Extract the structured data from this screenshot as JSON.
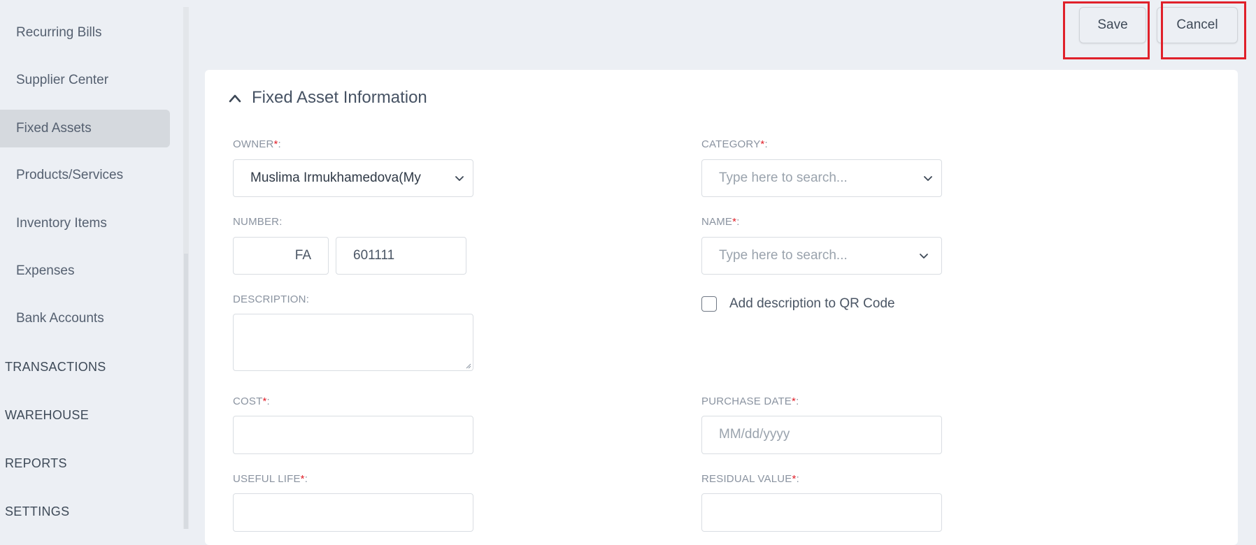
{
  "sidebar": {
    "items": [
      {
        "label": "Recurring Bills"
      },
      {
        "label": "Supplier Center"
      },
      {
        "label": "Fixed Assets",
        "active": true
      },
      {
        "label": "Products/Services"
      },
      {
        "label": "Inventory Items"
      },
      {
        "label": "Expenses"
      },
      {
        "label": "Bank Accounts"
      }
    ],
    "sections": [
      "TRANSACTIONS",
      "WAREHOUSE",
      "REPORTS",
      "SETTINGS"
    ]
  },
  "toolbar": {
    "save_label": "Save",
    "cancel_label": "Cancel",
    "highlight_color": "#e0202a"
  },
  "form": {
    "section_title": "Fixed Asset Information",
    "owner": {
      "label": "OWNER",
      "value": "Muslima Irmukhamedova(My"
    },
    "category": {
      "label": "CATEGORY",
      "placeholder": "Type here to search..."
    },
    "number": {
      "label": "NUMBER:",
      "prefix": "FA",
      "value": "601111"
    },
    "name": {
      "label": "NAME",
      "placeholder": "Type here to search..."
    },
    "description": {
      "label": "DESCRIPTION:"
    },
    "qr_checkbox_label": "Add description to QR Code",
    "cost": {
      "label": "COST"
    },
    "purchase_date": {
      "label": "PURCHASE DATE",
      "placeholder": "MM/dd/yyyy"
    },
    "useful_life": {
      "label": "USEFUL LIFE"
    },
    "residual_value": {
      "label": "RESIDUAL VALUE"
    },
    "required_mark": "*",
    "colon": ":"
  }
}
